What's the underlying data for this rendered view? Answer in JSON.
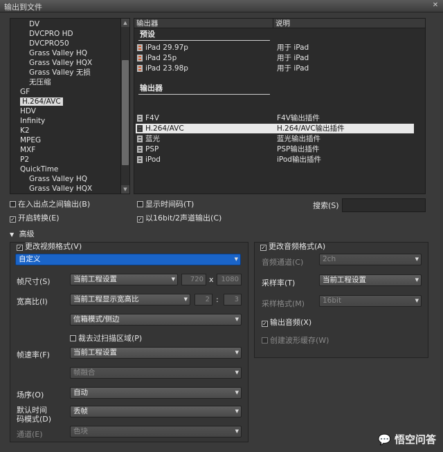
{
  "window": {
    "title": "输出到文件"
  },
  "tree": {
    "items": [
      {
        "label": "DV",
        "indent": 2
      },
      {
        "label": "DVCPRO HD",
        "indent": 2
      },
      {
        "label": "DVCPRO50",
        "indent": 2
      },
      {
        "label": "Grass Valley HQ",
        "indent": 2
      },
      {
        "label": "Grass Valley HQX",
        "indent": 2
      },
      {
        "label": "Grass Valley 无损",
        "indent": 2
      },
      {
        "label": "无压缩",
        "indent": 2
      },
      {
        "label": "GF",
        "indent": 1
      },
      {
        "label": "H.264/AVC",
        "indent": 1,
        "selected": true
      },
      {
        "label": "HDV",
        "indent": 1
      },
      {
        "label": "Infinity",
        "indent": 1
      },
      {
        "label": "K2",
        "indent": 1
      },
      {
        "label": "MPEG",
        "indent": 1
      },
      {
        "label": "MXF",
        "indent": 1
      },
      {
        "label": "P2",
        "indent": 1
      },
      {
        "label": "QuickTime",
        "indent": 1
      },
      {
        "label": "Grass Valley HQ",
        "indent": 2
      },
      {
        "label": "Grass Valley HQX",
        "indent": 2
      }
    ]
  },
  "list": {
    "col_exporter": "输出器",
    "col_desc": "说明",
    "presets_label": "预设",
    "presets": [
      {
        "name": "iPad 29.97p",
        "desc": "用于 iPad"
      },
      {
        "name": "iPad 25p",
        "desc": "用于 iPad"
      },
      {
        "name": "iPad 23.98p",
        "desc": "用于 iPad"
      }
    ],
    "exporters_label": "输出器",
    "exporters": [
      {
        "name": "F4V",
        "desc": "F4V输出插件"
      },
      {
        "name": "H.264/AVC",
        "desc": "H.264/AVC输出插件",
        "selected": true
      },
      {
        "name": "蓝光",
        "desc": "蓝光输出插件"
      },
      {
        "name": "PSP",
        "desc": "PSP输出插件"
      },
      {
        "name": "iPod",
        "desc": "iPod输出插件"
      }
    ]
  },
  "options": {
    "in_out": "在入出点之间输出(B)",
    "enable_convert": "开启转换(E)",
    "show_timecode": "显示时间码(T)",
    "sixteen_bit": "以16bit/2声道输出(C)",
    "search_label": "搜索(S)"
  },
  "advanced": {
    "label": "高级",
    "video": {
      "change_format": "更改视频格式(V)",
      "custom": "自定义",
      "frame_size_label": "帧尺寸(S)",
      "frame_size_value": "当前工程设置",
      "width": "720",
      "x_sep": "x",
      "height": "1080",
      "aspect_label": "宽高比(I)",
      "aspect_value": "当前工程显示宽高比",
      "aspect_w": "2",
      "aspect_sep": ":",
      "aspect_h": "3",
      "letterbox": "信箱模式/侧边",
      "crop_overscan": "裁去过扫描区域(P)",
      "framerate_label": "帧速率(F)",
      "framerate_value": "当前工程设置",
      "frame_blend": "帧融合",
      "field_order_label": "场序(O)",
      "field_order_value": "自动",
      "timecode_label_1": "默认时间",
      "timecode_label_2": "码模式(D)",
      "timecode_value": "丢帧",
      "channel_label": "通道(E)",
      "channel_value": "色块"
    },
    "audio": {
      "change_format": "更改音频格式(A)",
      "channels_label": "音频通道(C)",
      "channels_value": "2ch",
      "samplerate_label": "采样率(T)",
      "samplerate_value": "当前工程设置",
      "sampleformat_label": "采样格式(M)",
      "sampleformat_value": "16bit",
      "output_audio": "输出音频(X)",
      "waveform_cache": "创建波形缓存(W)"
    }
  },
  "watermark": "悟空问答"
}
